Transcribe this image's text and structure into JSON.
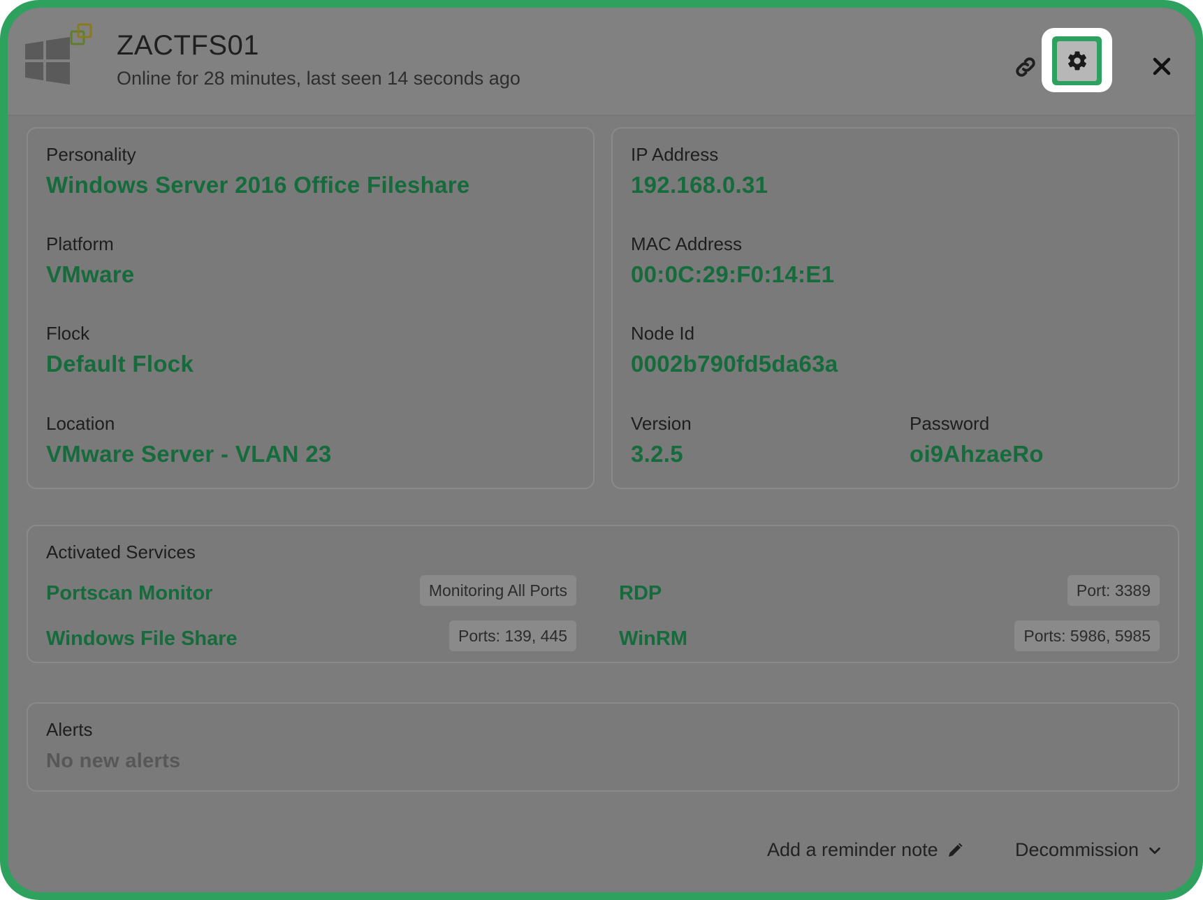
{
  "header": {
    "title": "ZACTFS01",
    "subtitle": "Online for 28 minutes, last seen 14 seconds ago",
    "os_icon": "windows-logo-icon",
    "badge_icon": "vmware-icon",
    "link_icon": "link-icon",
    "settings_icon": "gear-icon",
    "close_icon": "close-icon"
  },
  "details_left": {
    "personality_label": "Personality",
    "personality_value": "Windows Server 2016 Office Fileshare",
    "platform_label": "Platform",
    "platform_value": "VMware",
    "flock_label": "Flock",
    "flock_value": "Default Flock",
    "location_label": "Location",
    "location_value": "VMware Server - VLAN 23"
  },
  "details_right": {
    "ip_label": "IP Address",
    "ip_value": "192.168.0.31",
    "mac_label": "MAC Address",
    "mac_value": "00:0C:29:F0:14:E1",
    "node_label": "Node Id",
    "node_value": "0002b790fd5da63a",
    "version_label": "Version",
    "version_value": "3.2.5",
    "password_label": "Password",
    "password_value": "oi9AhzaeRo"
  },
  "services": {
    "title": "Activated Services",
    "items": [
      {
        "name": "Portscan Monitor",
        "detail": "Monitoring All Ports"
      },
      {
        "name": "Windows File Share",
        "detail": "Ports: 139, 445"
      },
      {
        "name": "RDP",
        "detail": "Port: 3389"
      },
      {
        "name": "WinRM",
        "detail": "Ports: 5986, 5985"
      }
    ]
  },
  "alerts": {
    "title": "Alerts",
    "value": "No new alerts"
  },
  "footer": {
    "reminder_label": "Add a reminder note",
    "reminder_icon": "pencil-icon",
    "decommission_label": "Decommission",
    "decommission_icon": "chevron-down-icon"
  },
  "colors": {
    "accent": "#2fa15f",
    "value_text": "#156b3b",
    "overlay": "#7c7c7c"
  }
}
